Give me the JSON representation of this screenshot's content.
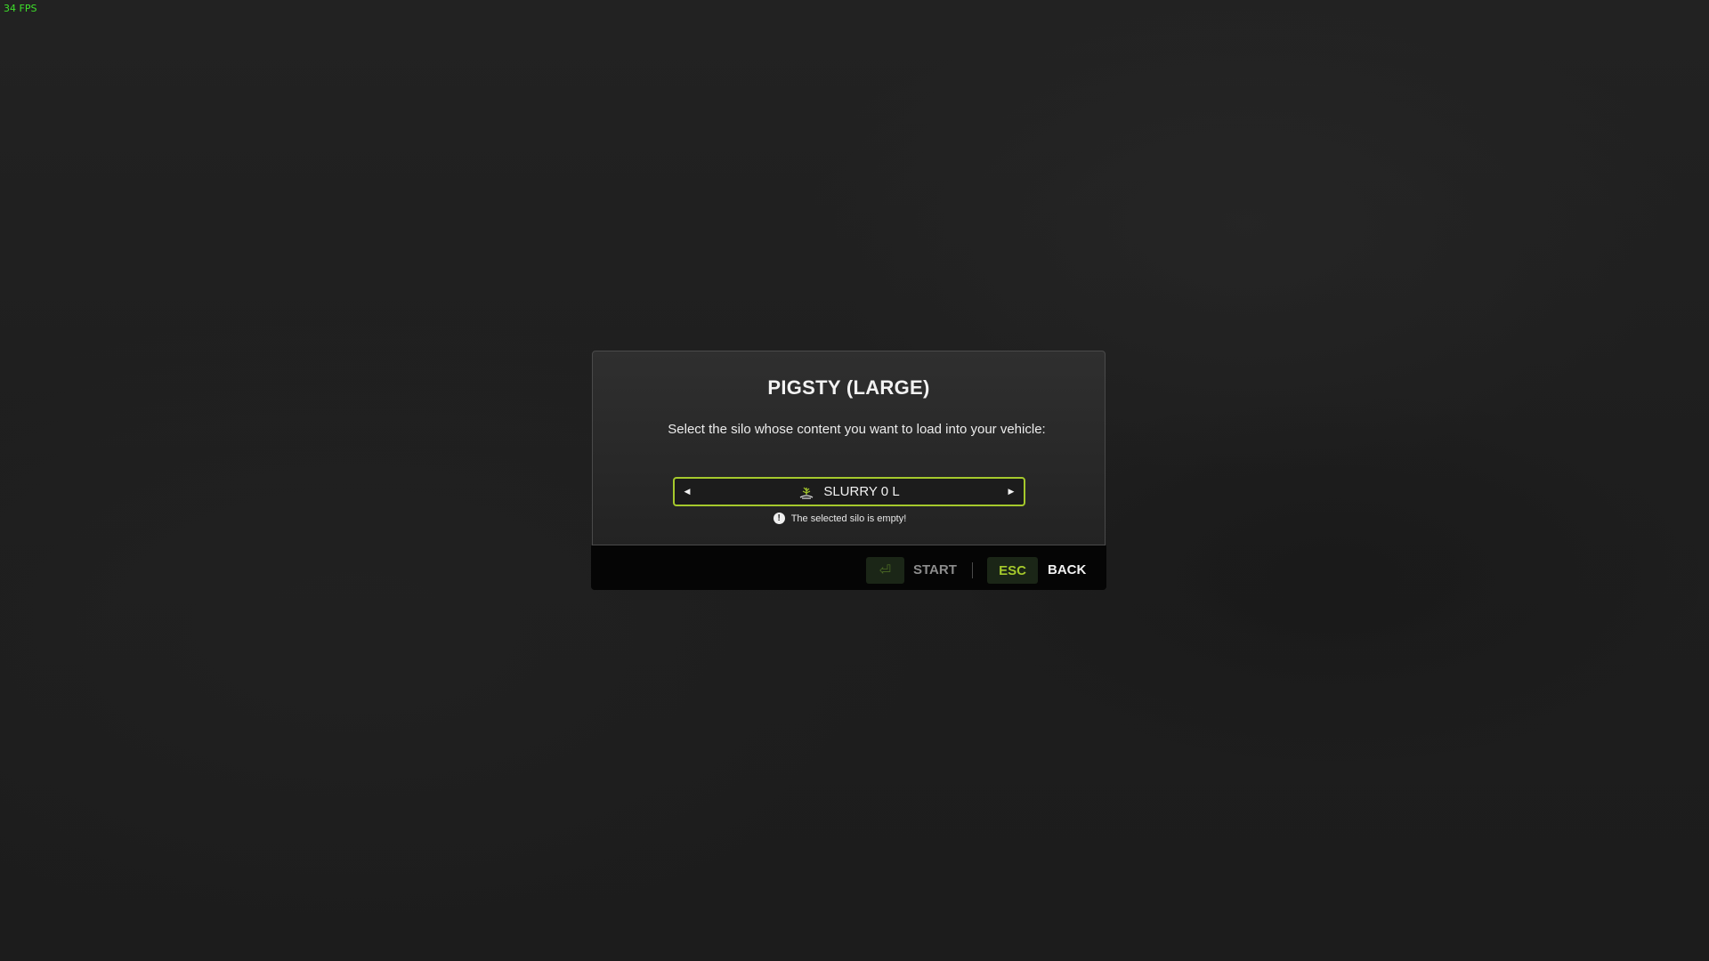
{
  "hud": {
    "fps": "34 FPS"
  },
  "dialog": {
    "title": "PIGSTY (LARGE)",
    "text": "Select the silo whose content you want to load into your vehicle:",
    "selector": {
      "value": "SLURRY 0 L",
      "icon": "slurry-icon",
      "left_arrow": "◀",
      "right_arrow": "▶"
    },
    "warning": {
      "icon": "exclamation-icon",
      "text": "The selected silo is empty!"
    }
  },
  "footer": {
    "start_key": "⏎",
    "start_label": "START",
    "back_key": "ESC",
    "back_label": "BACK"
  },
  "colors": {
    "accent": "#a5c92c",
    "fps": "#3ee02a",
    "background": "#1f1f1f"
  }
}
